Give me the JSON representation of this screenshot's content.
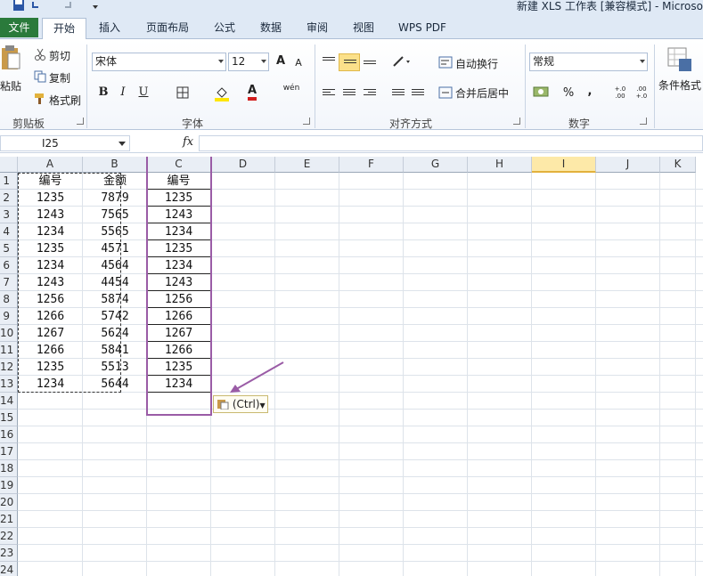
{
  "window": {
    "title": "新建 XLS 工作表 [兼容模式] - Microso"
  },
  "tabs": [
    {
      "label": "文件"
    },
    {
      "label": "开始"
    },
    {
      "label": "插入"
    },
    {
      "label": "页面布局"
    },
    {
      "label": "公式"
    },
    {
      "label": "数据"
    },
    {
      "label": "审阅"
    },
    {
      "label": "视图"
    },
    {
      "label": "WPS PDF"
    }
  ],
  "ribbon": {
    "clipboard": {
      "paste_label": "粘贴",
      "cut_label": "剪切",
      "copy_label": "复制",
      "format_painter_label": "格式刷",
      "group_label": "剪贴板"
    },
    "font": {
      "font_name": "宋体",
      "font_size": "12",
      "bold": "B",
      "italic": "I",
      "underline": "U",
      "font_color_glyph": "A",
      "grow_glyph": "A",
      "shrink_glyph": "A",
      "phonetic_glyph": "wén",
      "group_label": "字体"
    },
    "alignment": {
      "wrap_label": "自动换行",
      "merge_label": "合并后居中",
      "group_label": "对齐方式"
    },
    "number": {
      "format": "常规",
      "percent_glyph": "%",
      "comma_glyph": ",",
      "inc_decimal": "+.0 .00",
      "dec_decimal": ".00 +.0",
      "group_label": "数字"
    },
    "styles": {
      "conditional_label": "条件格式"
    }
  },
  "formula_bar": {
    "name_box": "I25",
    "fx_label": "fx",
    "formula": ""
  },
  "sheet": {
    "columns": [
      "A",
      "B",
      "C",
      "D",
      "E",
      "F",
      "G",
      "H",
      "I",
      "J",
      "K"
    ],
    "rows": [
      "1",
      "2",
      "3",
      "4",
      "5",
      "6",
      "7",
      "8",
      "9",
      "10",
      "11",
      "12",
      "13",
      "14",
      "15",
      "16",
      "17",
      "18",
      "19",
      "20",
      "21",
      "22",
      "23",
      "24"
    ],
    "data": [
      [
        "编号",
        "金额",
        "编号"
      ],
      [
        "1235",
        "7879",
        "1235"
      ],
      [
        "1243",
        "7565",
        "1243"
      ],
      [
        "1234",
        "5565",
        "1234"
      ],
      [
        "1235",
        "4571",
        "1235"
      ],
      [
        "1234",
        "4564",
        "1234"
      ],
      [
        "1243",
        "4454",
        "1243"
      ],
      [
        "1256",
        "5874",
        "1256"
      ],
      [
        "1266",
        "5742",
        "1266"
      ],
      [
        "1267",
        "5624",
        "1267"
      ],
      [
        "1266",
        "5841",
        "1266"
      ],
      [
        "1235",
        "5513",
        "1235"
      ],
      [
        "1234",
        "5644",
        "1234"
      ]
    ],
    "selected_column": "I",
    "paste_options_label": "(Ctrl)"
  },
  "colors": {
    "file_tab": "#2a7a3b",
    "highlight_box": "#9a5ca6",
    "selected_header": "#fde9a8"
  },
  "icons": {
    "save": "save-icon",
    "undo": "undo-icon",
    "redo": "redo-icon",
    "cut": "scissors-icon",
    "copy": "copy-icon",
    "paste": "clipboard-icon",
    "brush": "format-painter-icon",
    "border": "border-icon",
    "fill": "fill-bucket-icon",
    "arrow": "annotation-arrow-icon"
  }
}
